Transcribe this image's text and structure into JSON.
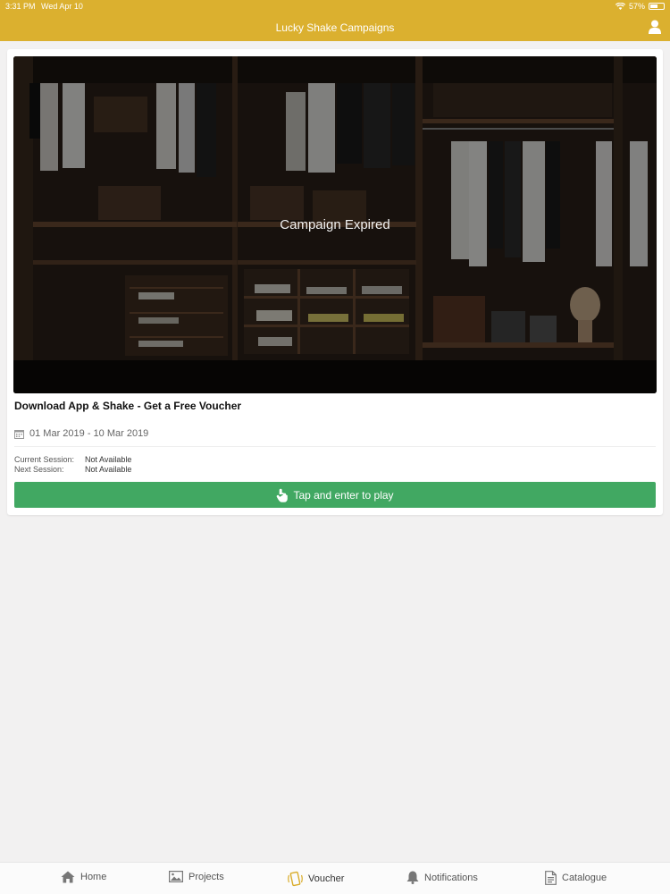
{
  "status_bar": {
    "time": "3:31 PM",
    "date": "Wed Apr 10",
    "battery": "57%",
    "battery_level": 0.57
  },
  "header": {
    "title": "Lucky Shake Campaigns",
    "profile_icon": "user-icon"
  },
  "campaign": {
    "status_overlay": "Campaign Expired",
    "title": "Download App & Shake - Get a Free Voucher",
    "date_range": "01 Mar 2019 - 10 Mar 2019",
    "current_session_label": "Current Session:",
    "current_session_value": "Not Available",
    "next_session_label": "Next Session:",
    "next_session_value": "Not Available",
    "play_button_label": "Tap and enter to play"
  },
  "tabs": [
    {
      "label": "Home",
      "icon": "home-icon"
    },
    {
      "label": "Projects",
      "icon": "image-icon"
    },
    {
      "label": "Voucher",
      "icon": "shake-phone-icon",
      "active": true
    },
    {
      "label": "Notifications",
      "icon": "bell-icon"
    },
    {
      "label": "Catalogue",
      "icon": "document-icon"
    }
  ],
  "colors": {
    "brand": "#dbb02f",
    "play_button": "#41a862",
    "background": "#f2f1f1"
  }
}
